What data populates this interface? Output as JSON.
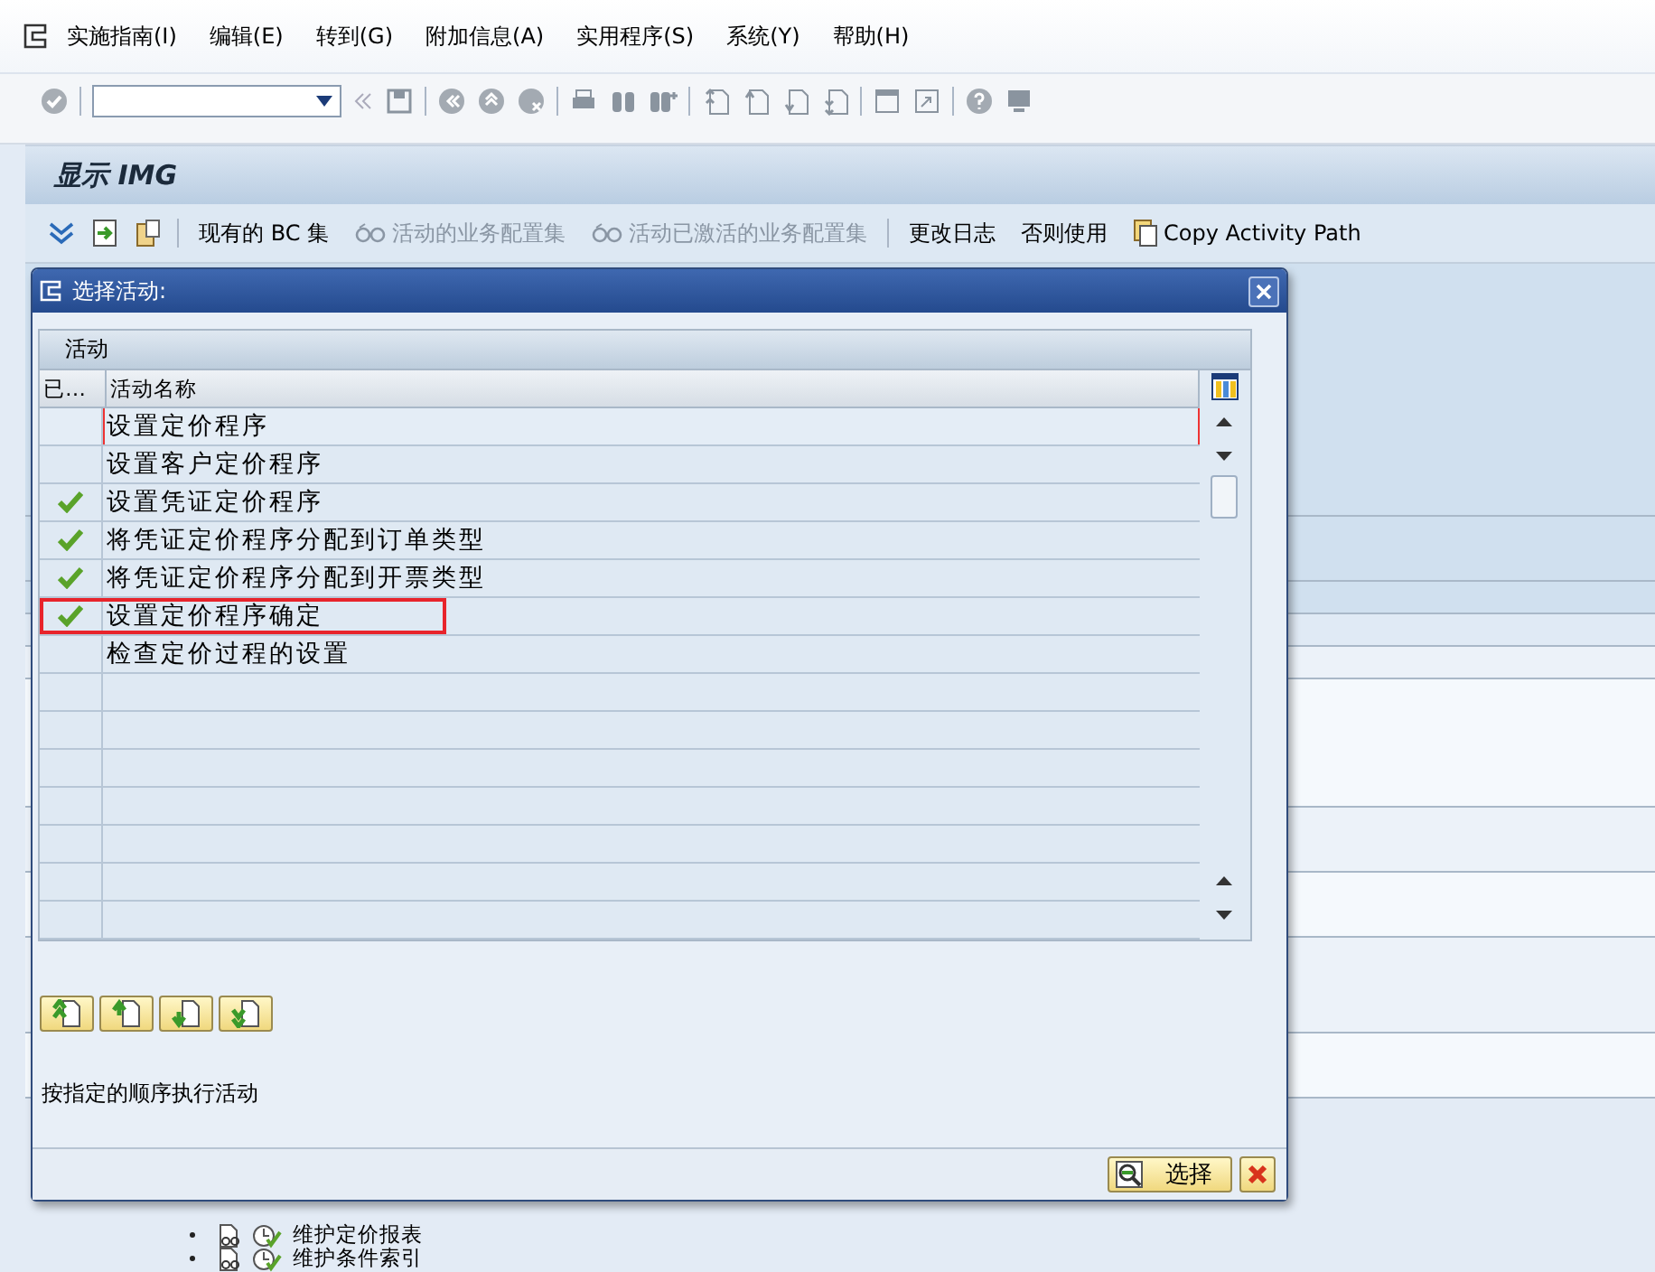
{
  "menu": {
    "items": [
      {
        "label": "实施指南(I)"
      },
      {
        "label": "编辑(E)"
      },
      {
        "label": "转到(G)"
      },
      {
        "label": "附加信息(A)"
      },
      {
        "label": "实用程序(S)"
      },
      {
        "label": "系统(Y)"
      },
      {
        "label": "帮助(H)"
      }
    ]
  },
  "screen_title": "显示 IMG",
  "app_toolbar": {
    "items": [
      {
        "label": "现有的 BC 集",
        "disabled": false,
        "kind": "text"
      },
      {
        "label": "活动的业务配置集",
        "disabled": true,
        "kind": "glasses"
      },
      {
        "label": "活动已激活的业务配置集",
        "disabled": true,
        "kind": "glasses"
      },
      {
        "label": "更改日志",
        "disabled": false,
        "kind": "text"
      },
      {
        "label": "否则使用",
        "disabled": false,
        "kind": "text"
      },
      {
        "label": "Copy Activity Path",
        "disabled": false,
        "kind": "copy"
      }
    ]
  },
  "dialog": {
    "title": "选择活动:",
    "group_label": "活动",
    "columns": [
      "已…",
      "活动名称"
    ],
    "rows": [
      {
        "done": false,
        "name": "设置定价程序",
        "focused": true,
        "marked": false
      },
      {
        "done": false,
        "name": "设置客户定价程序",
        "focused": false,
        "marked": false
      },
      {
        "done": true,
        "name": "设置凭证定价程序",
        "focused": false,
        "marked": false
      },
      {
        "done": true,
        "name": "将凭证定价程序分配到订单类型",
        "focused": false,
        "marked": false
      },
      {
        "done": true,
        "name": "将凭证定价程序分配到开票类型",
        "focused": false,
        "marked": false
      },
      {
        "done": true,
        "name": "设置定价程序确定",
        "focused": false,
        "marked": true
      },
      {
        "done": false,
        "name": "检查定价过程的设置",
        "focused": false,
        "marked": false
      }
    ],
    "description": "按指定的顺序执行活动",
    "select_button": "选择"
  },
  "background_tree": [
    {
      "label": "维护定价报表"
    },
    {
      "label": "维护条件索引"
    }
  ]
}
